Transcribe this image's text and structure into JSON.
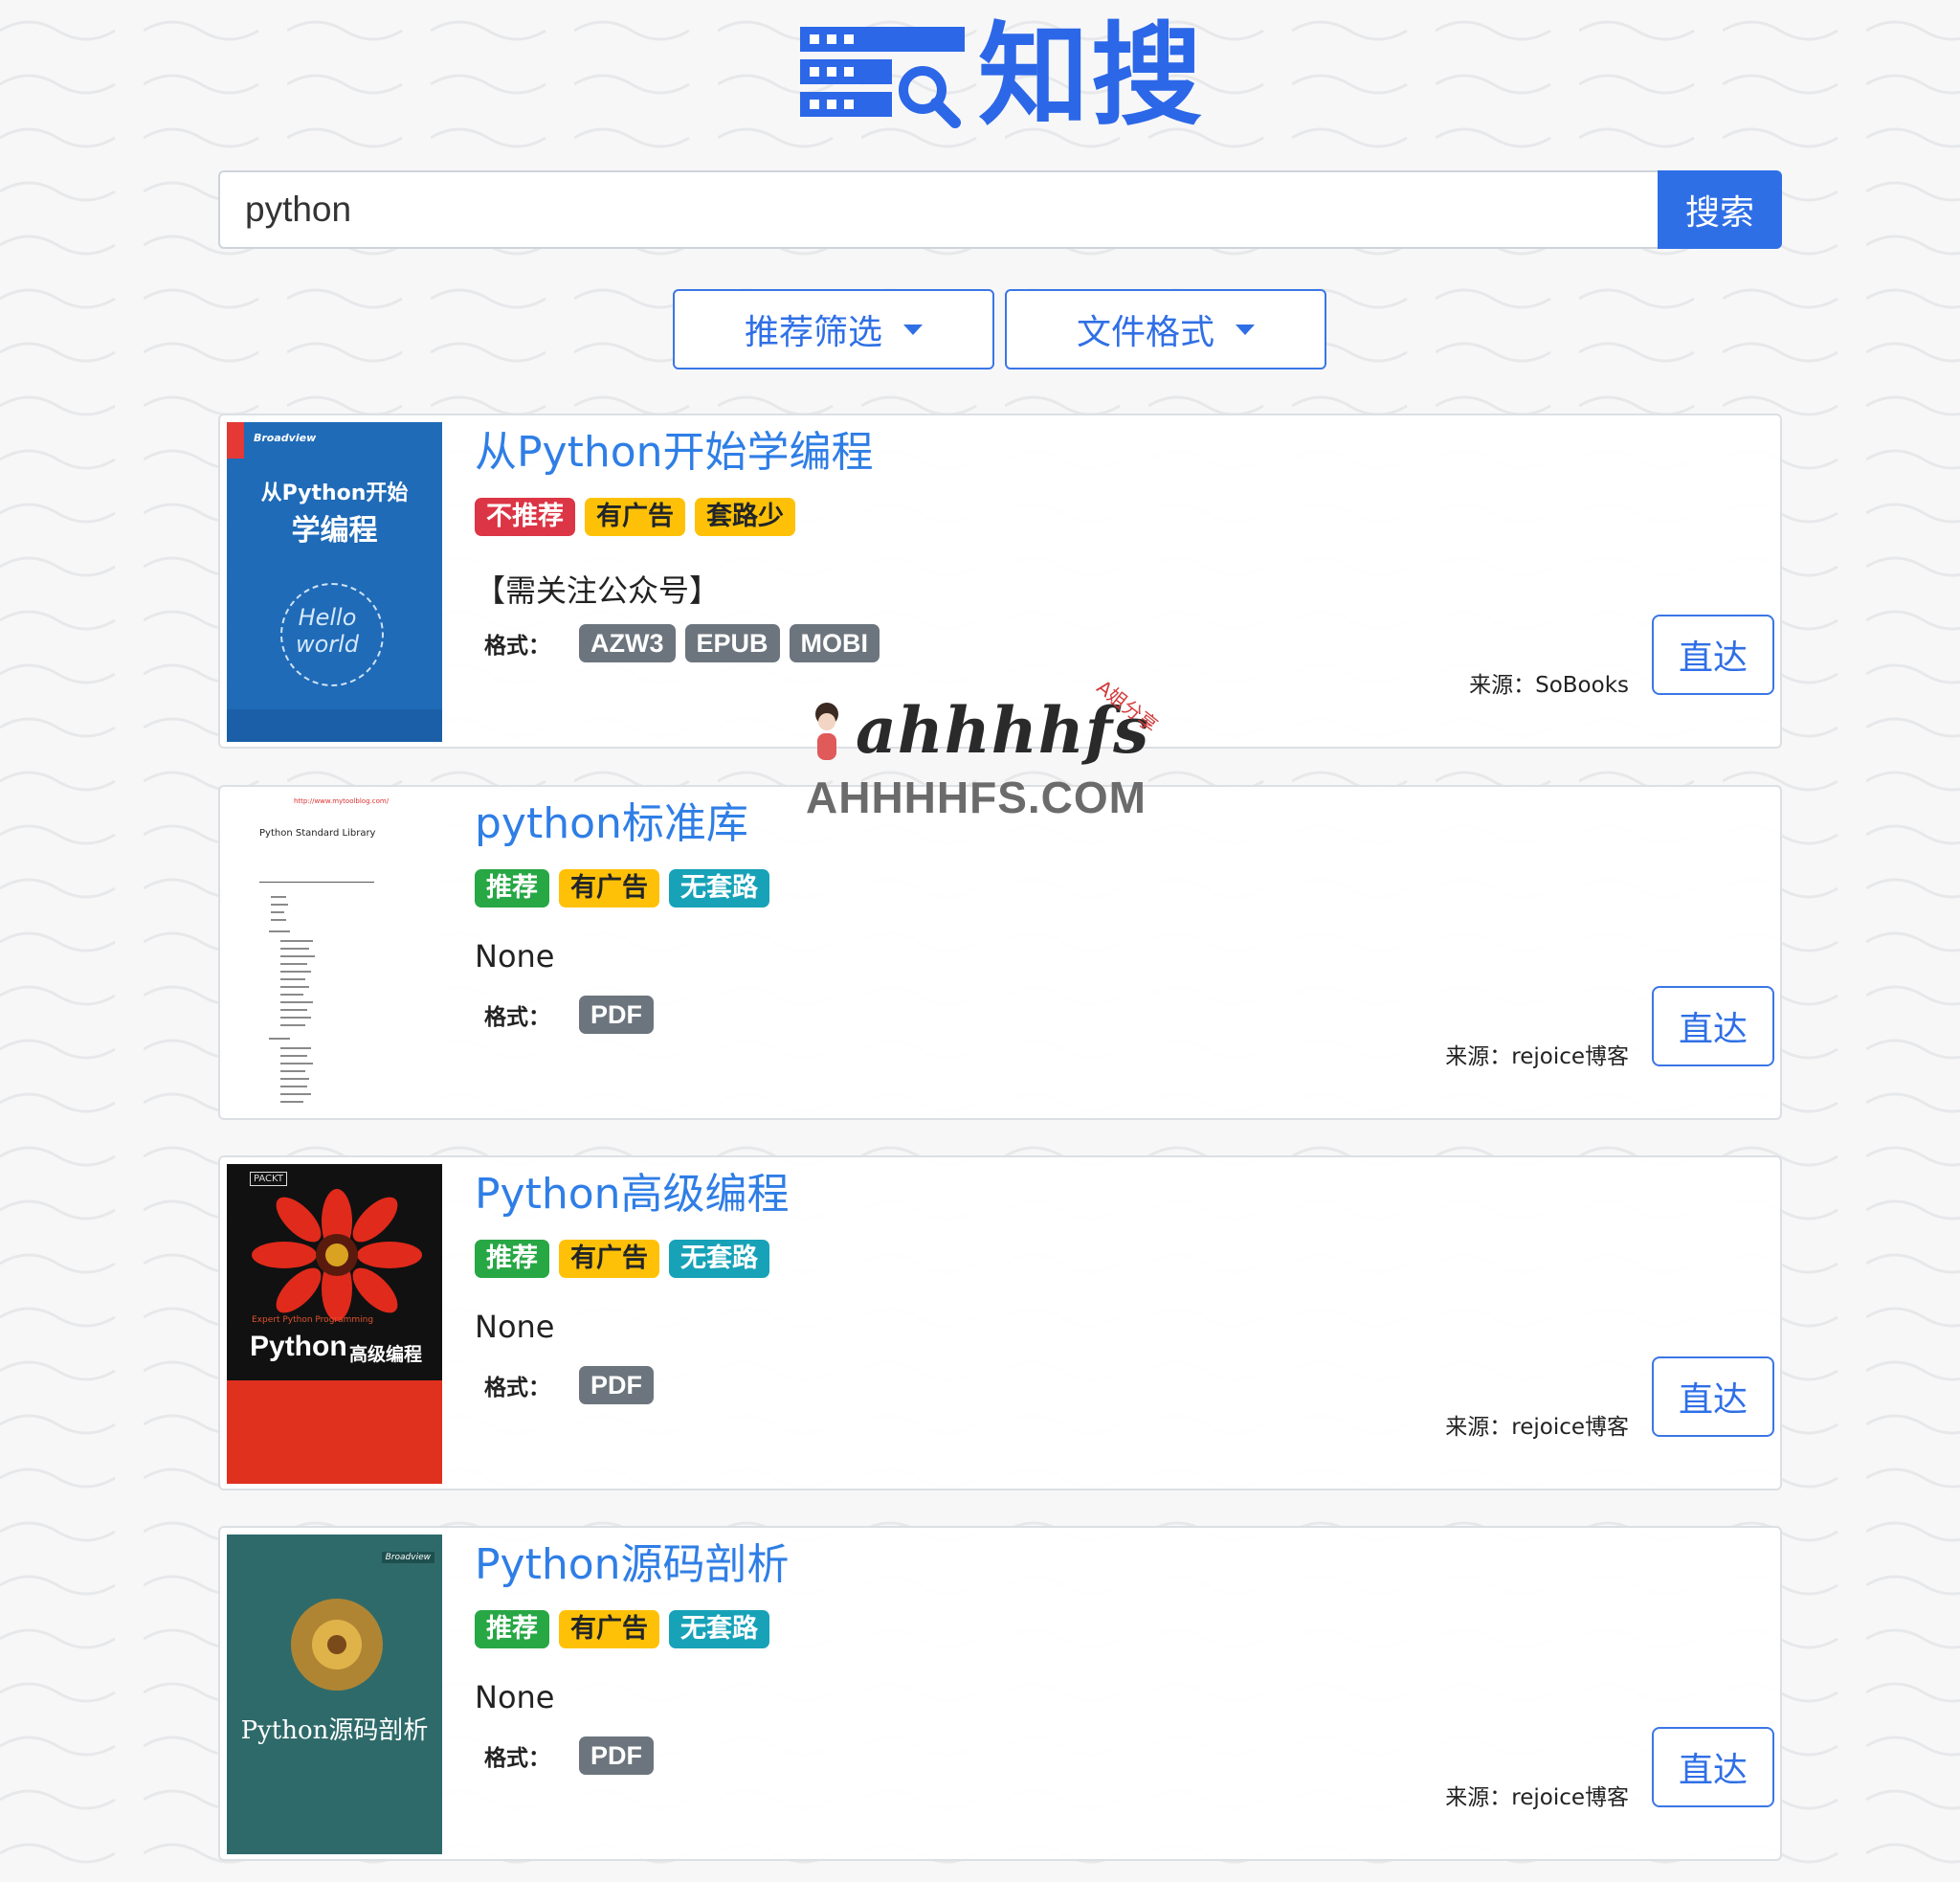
{
  "logo": {
    "text": "知搜"
  },
  "search": {
    "value": "python",
    "button_label": "搜索"
  },
  "filters": [
    {
      "label": "推荐筛选"
    },
    {
      "label": "文件格式"
    }
  ],
  "results": [
    {
      "title": "从Python开始学编程",
      "cover_title": [
        "从Python开始",
        "学编程"
      ],
      "cover_publisher": "Broadview",
      "cover_art_text": "Hello world",
      "tags": [
        {
          "label": "不推荐",
          "color": "red"
        },
        {
          "label": "有广告",
          "color": "yellow"
        },
        {
          "label": "套路少",
          "color": "yellow"
        }
      ],
      "note": "【需关注公众号】",
      "format_label": "格式：",
      "formats": [
        "AZW3",
        "EPUB",
        "MOBI"
      ],
      "source": "来源：SoBooks",
      "action": "直达"
    },
    {
      "title": "python标准库",
      "cover_title": [
        "Python Standard Library"
      ],
      "cover_url": "http://www.mytoolblog.com/",
      "tags": [
        {
          "label": "推荐",
          "color": "green"
        },
        {
          "label": "有广告",
          "color": "yellow"
        },
        {
          "label": "无套路",
          "color": "teal"
        }
      ],
      "note": "None",
      "format_label": "格式：",
      "formats": [
        "PDF"
      ],
      "source": "来源：rejoice博客",
      "action": "直达"
    },
    {
      "title": "Python高级编程",
      "cover_title": [
        "Python",
        "高级编程"
      ],
      "cover_publisher": "PACKT",
      "cover_subtitle": "Expert Python Programming",
      "tags": [
        {
          "label": "推荐",
          "color": "green"
        },
        {
          "label": "有广告",
          "color": "yellow"
        },
        {
          "label": "无套路",
          "color": "teal"
        }
      ],
      "note": "None",
      "format_label": "格式：",
      "formats": [
        "PDF"
      ],
      "source": "来源：rejoice博客",
      "action": "直达"
    },
    {
      "title": "Python源码剖析",
      "cover_title": [
        "Python源码剖析"
      ],
      "cover_publisher": "Broadview",
      "tags": [
        {
          "label": "推荐",
          "color": "green"
        },
        {
          "label": "有广告",
          "color": "yellow"
        },
        {
          "label": "无套路",
          "color": "teal"
        }
      ],
      "note": "None",
      "format_label": "格式：",
      "formats": [
        "PDF"
      ],
      "source": "来源：rejoice博客",
      "action": "直达"
    }
  ],
  "watermark": {
    "text": "ahhhhfs",
    "tag": "A姐分享",
    "domain": "AHHHHFS.COM"
  },
  "colors": {
    "primary": "#2f6fe6",
    "logo": "#2c67e8",
    "title_link": "#2f7ee6",
    "danger": "#dc3545",
    "success": "#28a745",
    "warning": "#ffc107",
    "info": "#17a2b8",
    "secondary": "#6c757d"
  }
}
